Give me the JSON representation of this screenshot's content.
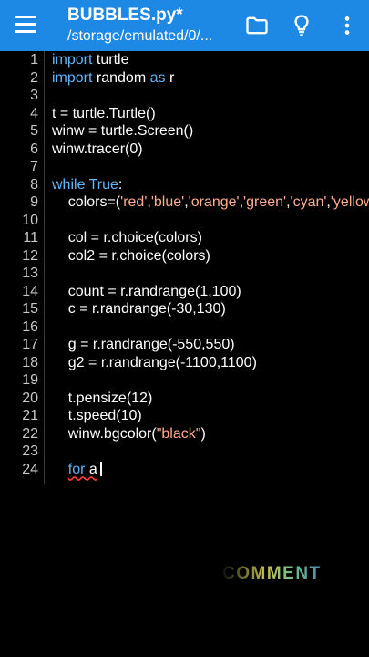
{
  "toolbar": {
    "title": "BUBBLES.py*",
    "path": "/storage/emulated/0/...",
    "icons": [
      "menu-icon",
      "folder-icon",
      "lightbulb-icon",
      "more-vert-icon"
    ]
  },
  "editor": {
    "lines": [
      {
        "n": "1",
        "segs": [
          {
            "t": "import",
            "k": "kw"
          },
          {
            "t": " turtle"
          }
        ]
      },
      {
        "n": "2",
        "segs": [
          {
            "t": "import",
            "k": "kw"
          },
          {
            "t": " random "
          },
          {
            "t": "as",
            "k": "kw"
          },
          {
            "t": " r"
          }
        ]
      },
      {
        "n": "3",
        "segs": []
      },
      {
        "n": "4",
        "segs": [
          {
            "t": "t = turtle.Turtle()"
          }
        ]
      },
      {
        "n": "5",
        "segs": [
          {
            "t": "winw = turtle.Screen()"
          }
        ]
      },
      {
        "n": "6",
        "segs": [
          {
            "t": "winw.tracer(0)"
          }
        ]
      },
      {
        "n": "7",
        "segs": []
      },
      {
        "n": "8",
        "segs": [
          {
            "t": "while True",
            "k": "kw"
          },
          {
            "t": ":"
          }
        ]
      },
      {
        "n": "9",
        "segs": [
          {
            "t": "    colors=("
          },
          {
            "t": "'red'",
            "k": "str"
          },
          {
            "t": ","
          },
          {
            "t": "'blue'",
            "k": "str"
          },
          {
            "t": ","
          },
          {
            "t": "'orange'",
            "k": "str"
          },
          {
            "t": ","
          },
          {
            "t": "'green'",
            "k": "str"
          },
          {
            "t": ","
          },
          {
            "t": "'cyan'",
            "k": "str"
          },
          {
            "t": ","
          },
          {
            "t": "'yellow",
            "k": "str"
          }
        ]
      },
      {
        "n": "10",
        "segs": []
      },
      {
        "n": "11",
        "segs": [
          {
            "t": "    col = r.choice(colors)"
          }
        ]
      },
      {
        "n": "12",
        "segs": [
          {
            "t": "    col2 = r.choice(colors)"
          }
        ]
      },
      {
        "n": "13",
        "segs": []
      },
      {
        "n": "14",
        "segs": [
          {
            "t": "    count = r.randrange(1,100)"
          }
        ]
      },
      {
        "n": "15",
        "segs": [
          {
            "t": "    c = r.randrange(-30,130)"
          }
        ]
      },
      {
        "n": "16",
        "segs": []
      },
      {
        "n": "17",
        "segs": [
          {
            "t": "    g = r.randrange(-550,550)"
          }
        ]
      },
      {
        "n": "18",
        "segs": [
          {
            "t": "    g2 = r.randrange(-1100,1100)"
          }
        ]
      },
      {
        "n": "19",
        "segs": []
      },
      {
        "n": "20",
        "segs": [
          {
            "t": "    t.pensize(12)"
          }
        ]
      },
      {
        "n": "21",
        "segs": [
          {
            "t": "    t.speed(10)"
          }
        ]
      },
      {
        "n": "22",
        "segs": [
          {
            "t": "    winw.bgcolor("
          },
          {
            "t": "\"black\"",
            "k": "str"
          },
          {
            "t": ")"
          }
        ]
      },
      {
        "n": "23",
        "segs": []
      },
      {
        "n": "24",
        "segs": [
          {
            "t": "    "
          },
          {
            "t": "for",
            "k": "kw",
            "sq": true
          },
          {
            "t": " a",
            "sq": true
          },
          {
            "cursor": true
          }
        ]
      }
    ]
  },
  "overlay": {
    "watermark_text": "COMMENT"
  },
  "colors": {
    "toolbar": "#1e88e5",
    "keyword": "#64b5f6",
    "string": "#ffab91",
    "background": "#000000"
  }
}
